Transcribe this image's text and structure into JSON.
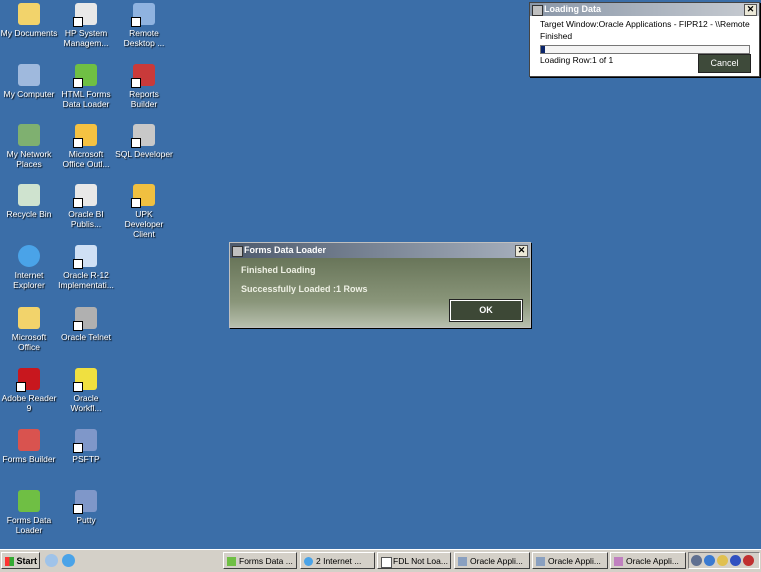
{
  "desktop": {
    "icons": [
      {
        "label": "My Documents",
        "icon": "folder-documents-icon"
      },
      {
        "label": "HP System Managem...",
        "icon": "hp-system-icon"
      },
      {
        "label": "Remote Desktop ...",
        "icon": "remote-desktop-icon"
      },
      {
        "label": "My Computer",
        "icon": "computer-icon"
      },
      {
        "label": "HTML Forms Data Loader",
        "icon": "fdl-icon"
      },
      {
        "label": "Reports Builder",
        "icon": "reports-builder-icon"
      },
      {
        "label": "My Network Places",
        "icon": "network-icon"
      },
      {
        "label": "Microsoft Office Outl...",
        "icon": "outlook-icon"
      },
      {
        "label": "SQL Developer",
        "icon": "sql-developer-icon"
      },
      {
        "label": "Recycle Bin",
        "icon": "recycle-bin-icon"
      },
      {
        "label": "Oracle BI Publis...",
        "icon": "bi-publisher-icon"
      },
      {
        "label": "UPK Developer Client",
        "icon": "upk-icon"
      },
      {
        "label": "Internet Explorer",
        "icon": "ie-icon"
      },
      {
        "label": "Oracle R-12 Implementati...",
        "icon": "oracle-r12-icon"
      },
      {
        "label": "Microsoft Office",
        "icon": "folder-icon"
      },
      {
        "label": "Oracle Telnet",
        "icon": "telnet-icon"
      },
      {
        "label": "Adobe Reader 9",
        "icon": "adobe-reader-icon"
      },
      {
        "label": "Oracle Workfl...",
        "icon": "workflow-icon"
      },
      {
        "label": "Forms Builder",
        "icon": "forms-builder-icon"
      },
      {
        "label": "PSFTP",
        "icon": "psftp-icon"
      },
      {
        "label": "Forms Data Loader",
        "icon": "fdl-icon"
      },
      {
        "label": "Putty",
        "icon": "putty-icon"
      }
    ]
  },
  "loading_window": {
    "title": "Loading Data",
    "target": "Target Window:Oracle Applications - FIPR12 - \\\\Remote",
    "status": "Finished",
    "progress_fraction": 0.02,
    "row_text": "Loading Row:1 of 1",
    "cancel_label": "Cancel",
    "close_glyph": "✕"
  },
  "fdl_dialog": {
    "title": "Forms Data Loader",
    "line1": "Finished Loading",
    "line2": "Successfully Loaded :1 Rows",
    "ok_label": "OK",
    "close_glyph": "✕"
  },
  "taskbar": {
    "start_label": "Start",
    "tasks": [
      {
        "label": "Forms Data ..."
      },
      {
        "label": "2 Internet ..."
      },
      {
        "label": "FDL Not Loa..."
      },
      {
        "label": "Oracle Appli..."
      },
      {
        "label": "Oracle Appli..."
      },
      {
        "label": "Oracle Appli..."
      }
    ]
  },
  "colors": {
    "desktop": "#3b6ea8",
    "titlebar_start": "#7b8aa0",
    "dialog_body": "#6f7d5e"
  }
}
